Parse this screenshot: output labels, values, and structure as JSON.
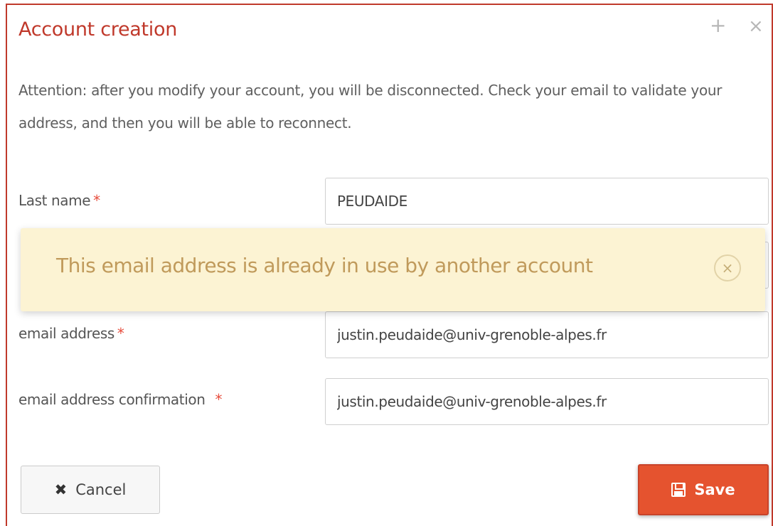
{
  "dialog": {
    "title": "Account creation",
    "plus_icon": "+",
    "close_icon": "×"
  },
  "notice": "Attention: after you modify your account, you will be disconnected. Check your email to validate your address, and then you will be able to reconnect.",
  "form": {
    "last_name": {
      "label": "Last name",
      "required_mark": "*",
      "value": "PEUDAIDE"
    },
    "email": {
      "label": "email address",
      "required_mark": "*",
      "value": "justin.peudaide@univ-grenoble-alpes.fr"
    },
    "email_confirm": {
      "label": "email address confirmation",
      "required_mark": "*",
      "value": "justin.peudaide@univ-grenoble-alpes.fr"
    }
  },
  "alert": {
    "message": "This email address is already in use by another account",
    "dismiss_icon": "×"
  },
  "buttons": {
    "cancel_icon": "✖",
    "cancel_label": "Cancel",
    "save_label": "Save"
  },
  "colors": {
    "accent": "#c0392b",
    "save_button": "#e5532f",
    "alert_bg": "#fcf3d3",
    "alert_text": "#c09a5b"
  },
  "icons": [
    "plus-icon",
    "close-icon",
    "alert-close-icon",
    "cancel-x-icon",
    "floppy-disk-icon"
  ]
}
